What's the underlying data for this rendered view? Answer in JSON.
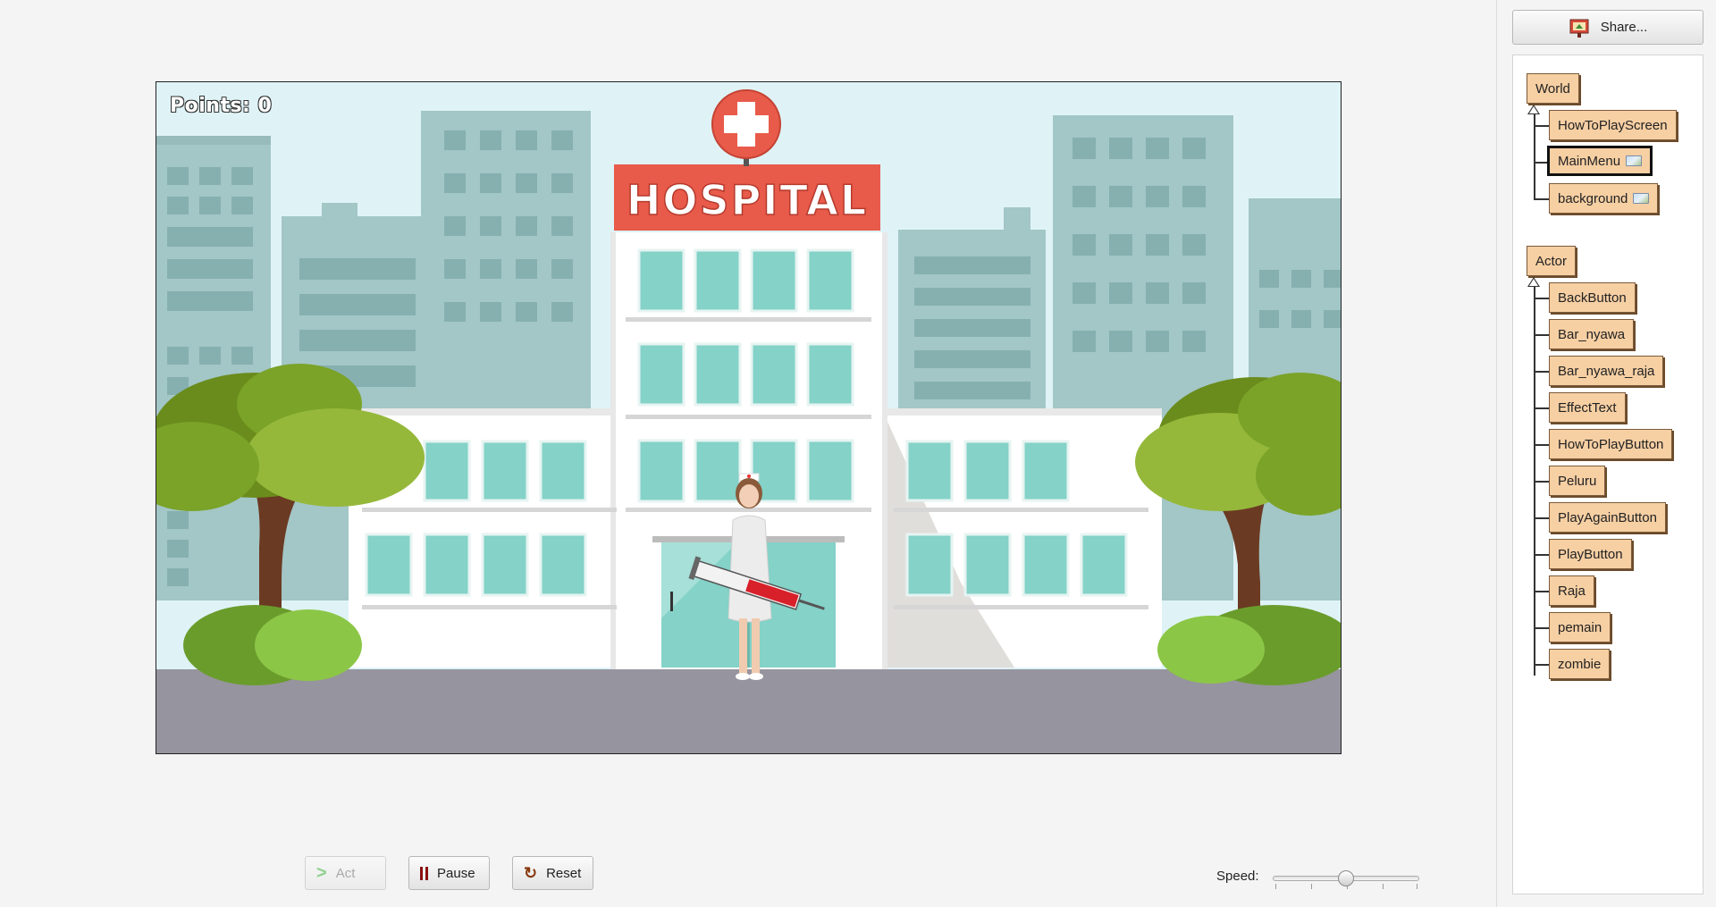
{
  "world": {
    "points_text": "Points: 0",
    "hospital_sign": "HOSPITAL"
  },
  "controls": {
    "act_label": "Act",
    "pause_label": "Pause",
    "reset_label": "Reset",
    "speed_label": "Speed:",
    "speed_value": 0.5
  },
  "side_panel": {
    "share_label": "Share...",
    "world_root": "World",
    "world_classes": [
      "HowToPlayScreen",
      "MainMenu",
      "background"
    ],
    "actor_root": "Actor",
    "actor_classes": [
      "BackButton",
      "Bar_nyawa",
      "Bar_nyawa_raja",
      "EffectText",
      "HowToPlayButton",
      "Peluru",
      "PlayAgainButton",
      "PlayButton",
      "Raja",
      "pemain",
      "zombie"
    ]
  },
  "colors": {
    "class_box": "#f6cfa3",
    "hospital_red": "#e85a4a",
    "window_teal": "#84d2c8",
    "building_gray": "#9fc3c3",
    "road": "#96949e"
  }
}
